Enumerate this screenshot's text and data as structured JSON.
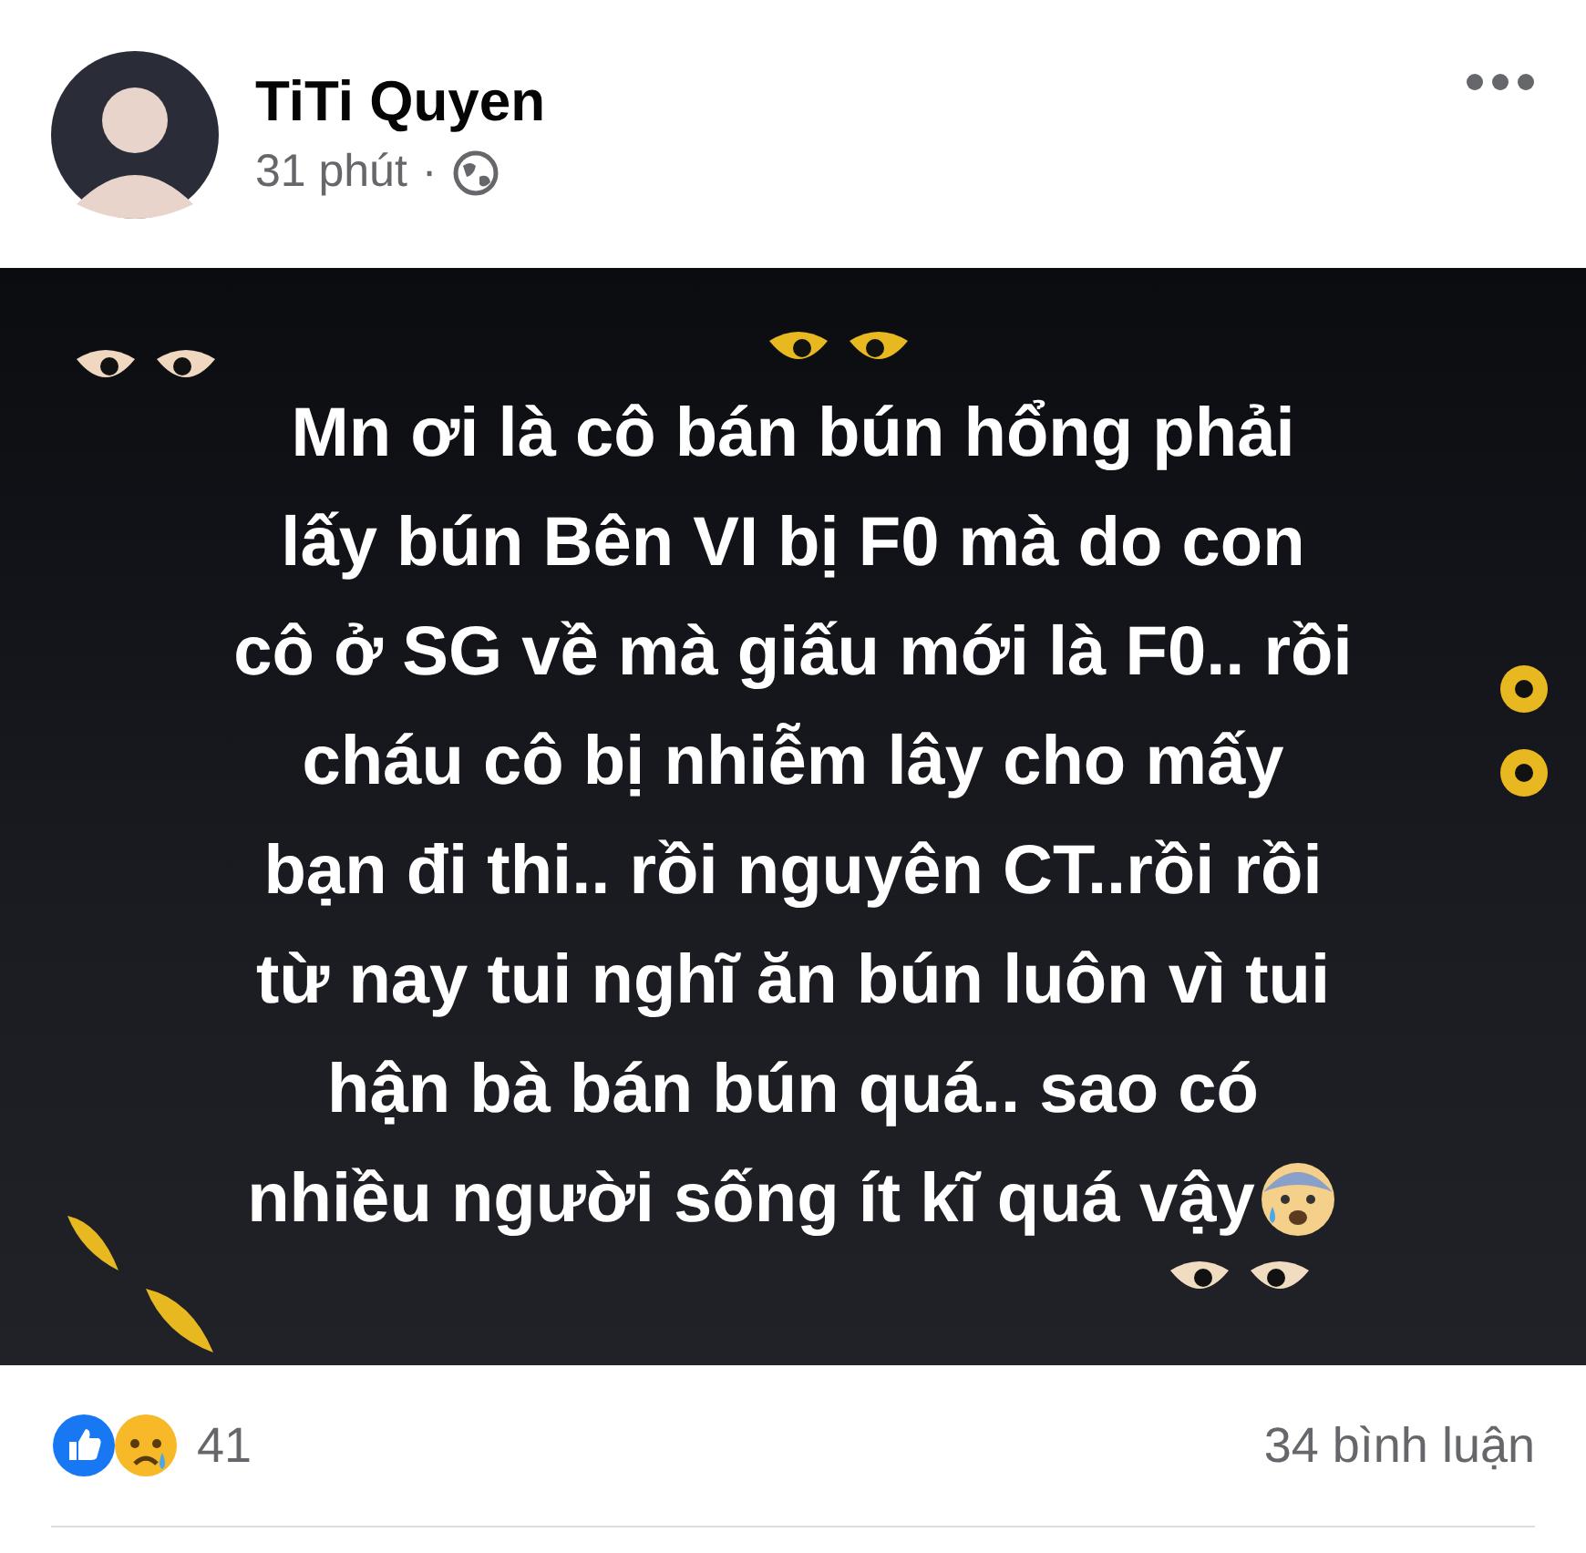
{
  "post": {
    "author": "TiTi Quyen",
    "time": "31 phút",
    "separator": "·",
    "lines": [
      "Mn ơi là cô bán bún hổng phải",
      "lấy bún Bên VI bị F0 mà do con",
      "cô ở SG về mà giấu mới là F0.. rồi",
      "cháu cô bị nhiễm lây cho mấy",
      "bạn đi thi.. rồi nguyên CT..rồi rồi",
      "từ nay tui nghĩ ăn bún luôn vì tui",
      "hận bà bán bún quá.. sao có",
      "nhiều người sống ít kĩ quá vậy"
    ],
    "reactions_count": "41",
    "comments": "34 bình luận"
  }
}
